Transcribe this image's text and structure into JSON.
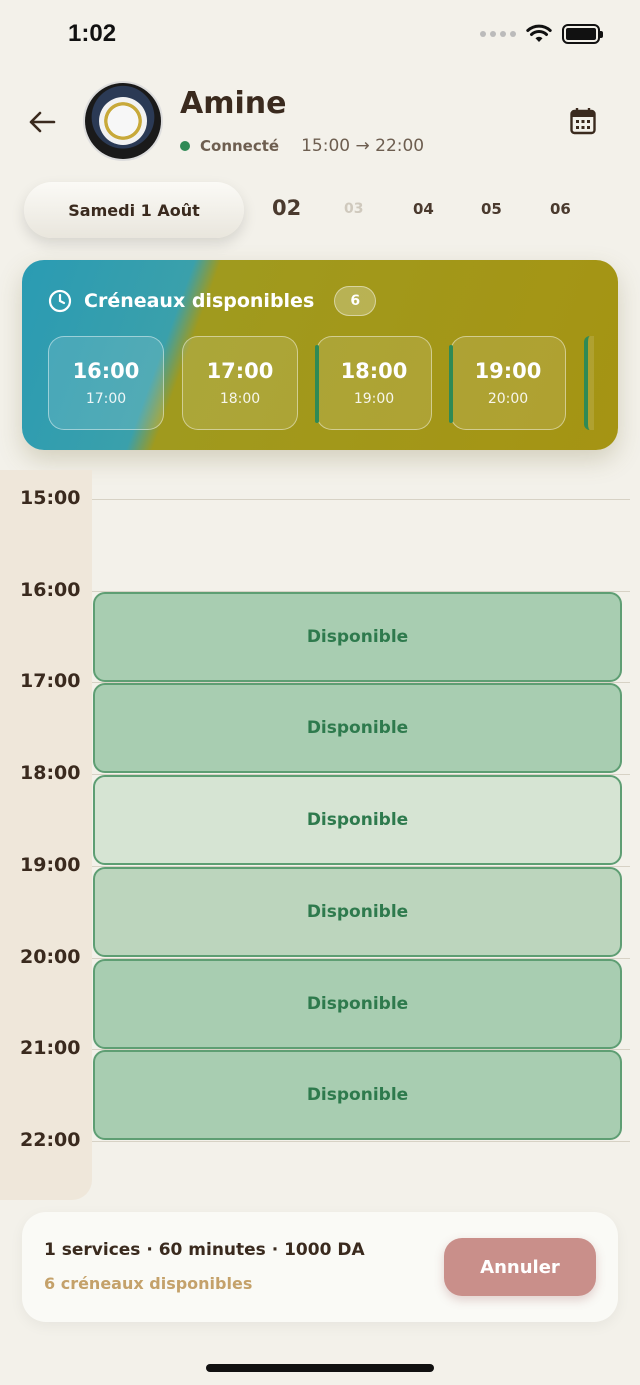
{
  "status_bar": {
    "time": "1:02"
  },
  "header": {
    "barber_name": "Amine",
    "presence": "Connecté",
    "hours": "15:00 → 22:00"
  },
  "date_strip": {
    "selected": "Samedi 1 Août",
    "days": [
      "02",
      "03",
      "04",
      "05",
      "06"
    ]
  },
  "slots_card": {
    "title": "Créneaux disponibles",
    "count": "6",
    "slots": [
      {
        "start": "16:00",
        "end": "17:00"
      },
      {
        "start": "17:00",
        "end": "18:00"
      },
      {
        "start": "18:00",
        "end": "19:00"
      },
      {
        "start": "19:00",
        "end": "20:00"
      }
    ]
  },
  "timeline": {
    "hours": [
      "15:00",
      "16:00",
      "17:00",
      "18:00",
      "19:00",
      "20:00",
      "21:00",
      "22:00"
    ],
    "blocks": [
      {
        "label": "Disponible",
        "color": "#a8cdb1"
      },
      {
        "label": "Disponible",
        "color": "#a8cdb1"
      },
      {
        "label": "Disponible",
        "color": "#d6e4d3"
      },
      {
        "label": "Disponible",
        "color": "#bcd5bd"
      },
      {
        "label": "Disponible",
        "color": "#a8cdb1"
      },
      {
        "label": "Disponible",
        "color": "#a8cdb1"
      }
    ]
  },
  "summary": {
    "main": "1 services · 60 minutes · 1000 DA",
    "sub": "6 créneaux disponibles",
    "cancel_label": "Annuler"
  },
  "colors": {
    "accent_green": "#2f8a55",
    "cancel": "#c98f8a",
    "sub_text": "#c4a16a"
  },
  "icons": {
    "back": "arrow-left-icon",
    "calendar": "calendar-icon",
    "clock": "clock-icon"
  }
}
